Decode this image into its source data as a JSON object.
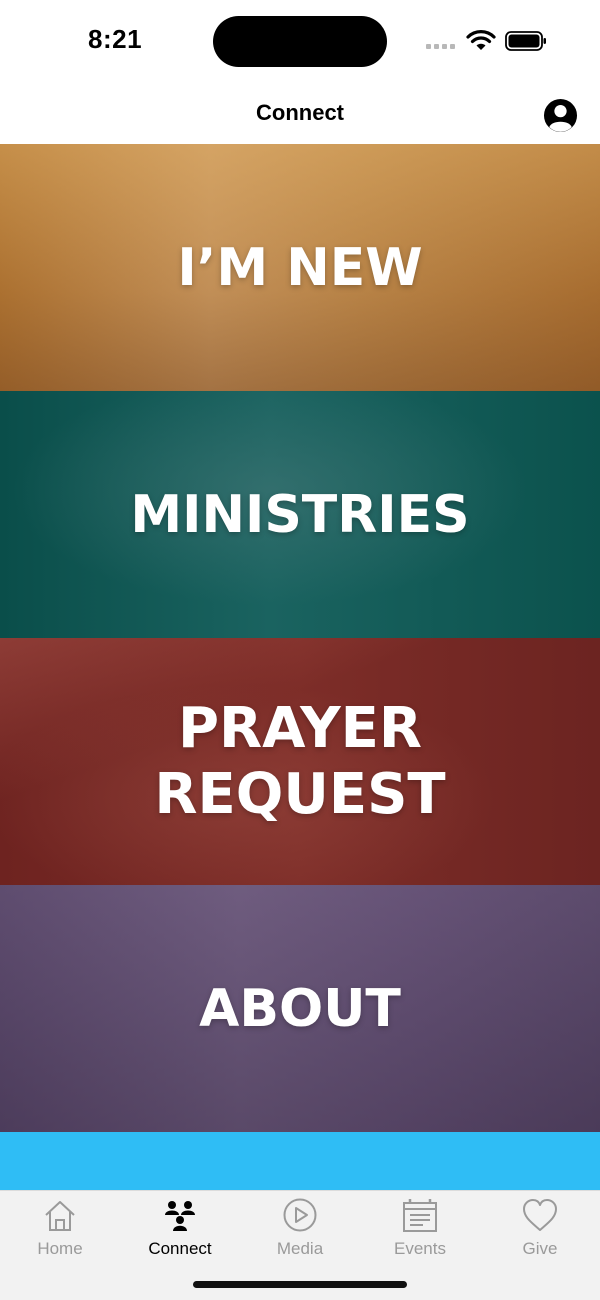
{
  "status_bar": {
    "time": "8:21"
  },
  "nav": {
    "title": "Connect",
    "profile_icon": "person-circle-icon"
  },
  "tiles": [
    {
      "label": "I’M NEW",
      "color": "#c3863f"
    },
    {
      "label": "MINISTRIES",
      "color": "#0d5651"
    },
    {
      "label": "PRAYER REQUEST",
      "color": "#7a2a25"
    },
    {
      "label": "ABOUT",
      "color": "#5a4868"
    }
  ],
  "strip": {
    "color": "#2fbdf5"
  },
  "tab_bar": {
    "active": "Connect",
    "tabs": [
      {
        "label": "Home",
        "icon": "home-icon"
      },
      {
        "label": "Connect",
        "icon": "people-icon"
      },
      {
        "label": "Media",
        "icon": "play-circle-icon"
      },
      {
        "label": "Events",
        "icon": "calendar-icon"
      },
      {
        "label": "Give",
        "icon": "heart-icon"
      }
    ]
  }
}
